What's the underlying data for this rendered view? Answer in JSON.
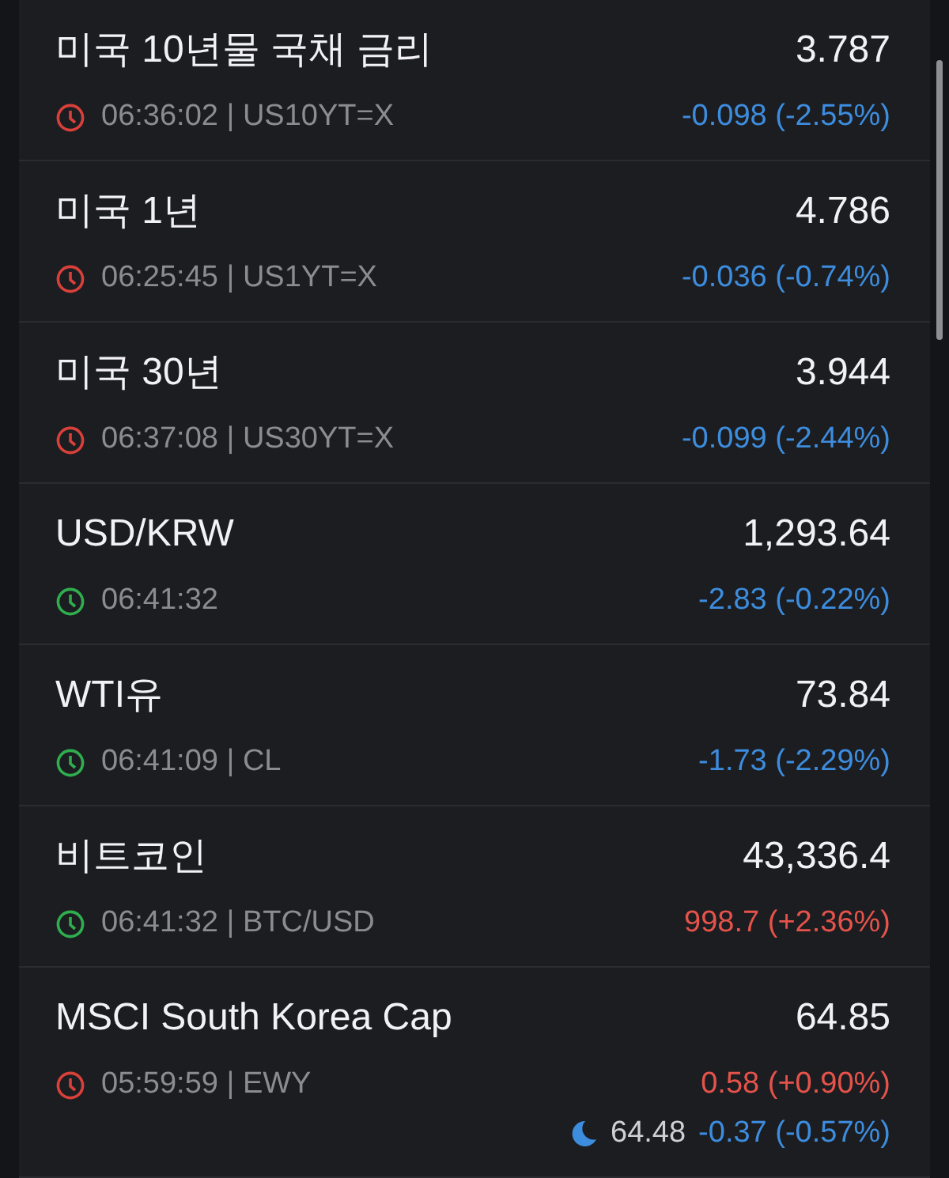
{
  "quotes": [
    {
      "name": "미국 10년물 국채 금리",
      "price": "3.787",
      "info": "06:36:02 | US10YT=X",
      "market_open": false,
      "change": "-0.098 (-2.55%)",
      "rising": false
    },
    {
      "name": "미국 1년",
      "price": "4.786",
      "info": "06:25:45 | US1YT=X",
      "market_open": false,
      "change": "-0.036 (-0.74%)",
      "rising": false
    },
    {
      "name": "미국 30년",
      "price": "3.944",
      "info": "06:37:08 | US30YT=X",
      "market_open": false,
      "change": "-0.099 (-2.44%)",
      "rising": false
    },
    {
      "name": "USD/KRW",
      "price": "1,293.64",
      "info": "06:41:32",
      "market_open": true,
      "change": "-2.83 (-0.22%)",
      "rising": false
    },
    {
      "name": "WTI유",
      "price": "73.84",
      "info": "06:41:09 | CL",
      "market_open": true,
      "change": "-1.73 (-2.29%)",
      "rising": false
    },
    {
      "name": "비트코인",
      "price": "43,336.4",
      "info": "06:41:32 | BTC/USD",
      "market_open": true,
      "change": "998.7 (+2.36%)",
      "rising": true
    },
    {
      "name": "MSCI South Korea Cap",
      "price": "64.85",
      "info": "05:59:59 | EWY",
      "market_open": false,
      "change": "0.58 (+0.90%)",
      "rising": true,
      "after_hours": {
        "price": "64.48",
        "change": "-0.37 (-0.57%)",
        "rising": false
      }
    }
  ]
}
